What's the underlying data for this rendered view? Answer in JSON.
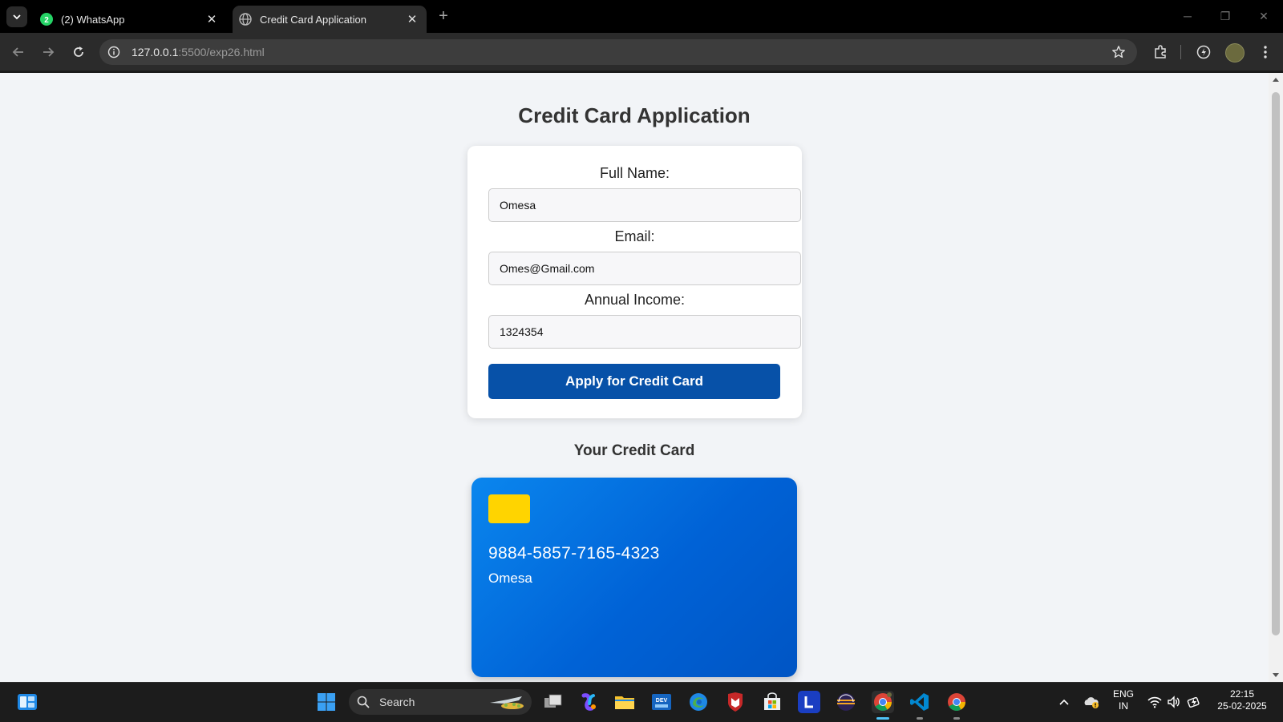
{
  "browser": {
    "tabs": [
      {
        "title": "(2) WhatsApp",
        "badge": "2",
        "active": false
      },
      {
        "title": "Credit Card Application",
        "active": true
      }
    ],
    "url": {
      "host": "127.0.0.1",
      "path": ":5500/exp26.html"
    }
  },
  "page": {
    "title": "Credit Card Application",
    "form": {
      "full_name_label": "Full Name:",
      "full_name_value": "Omesa",
      "email_label": "Email:",
      "email_value": "Omes@Gmail.com",
      "income_label": "Annual Income:",
      "income_value": "1324354",
      "submit_label": "Apply for Credit Card"
    },
    "card_section_title": "Your Credit Card",
    "card": {
      "number": "9884-5857-7165-4323",
      "holder": "Omesa"
    }
  },
  "taskbar": {
    "search_label": "Search",
    "language": "ENG",
    "region": "IN",
    "time": "22:15",
    "date": "25-02-2025"
  },
  "colors": {
    "primary_button": "#0751a8",
    "card_gradient_start": "#0a86ee",
    "card_gradient_end": "#0055c4",
    "chip": "#ffd400"
  }
}
